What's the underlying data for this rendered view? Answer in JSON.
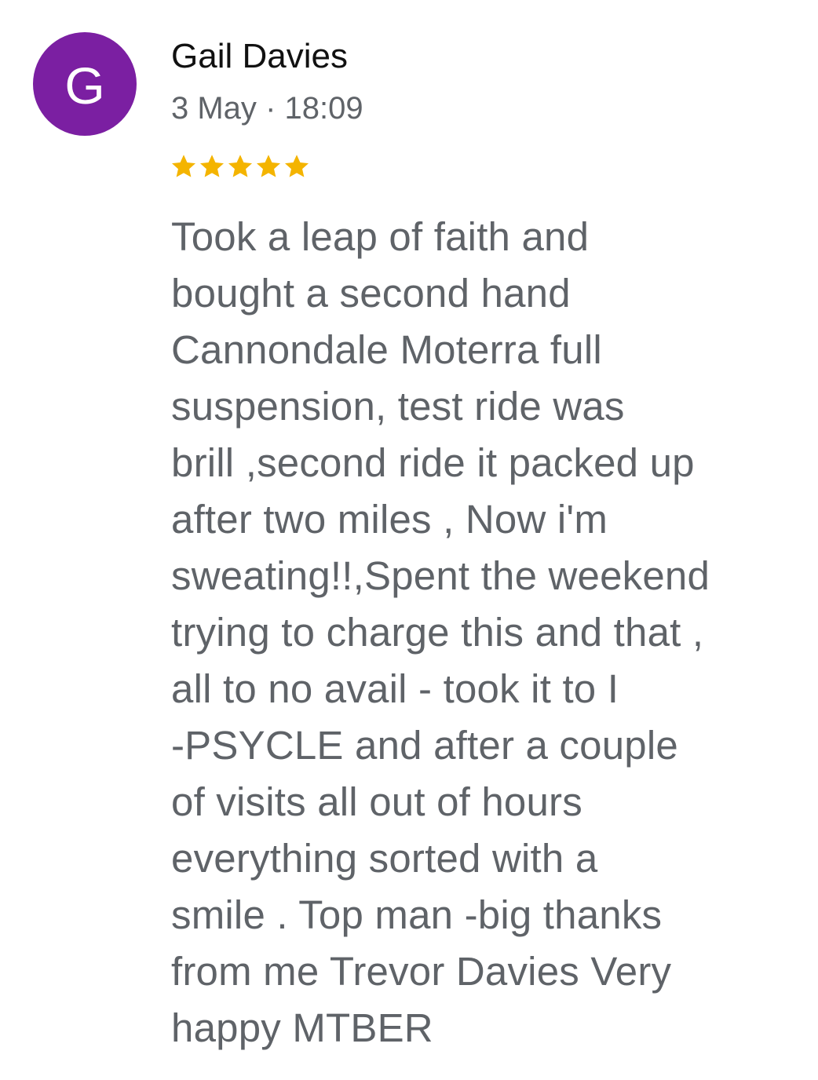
{
  "review": {
    "avatar_letter": "G",
    "avatar_color": "#7b1fa2",
    "author_name": "Gail Davies",
    "date": "3 May",
    "separator": "·",
    "time": "18:09",
    "rating": 5,
    "rating_max": 5,
    "star_color": "#f4b400",
    "star_icon": "star-icon",
    "text": "Took a leap of faith and\nbought a second hand\nCannondale Moterra full\nsuspension, test ride was\nbrill ,second ride it packed up\nafter two miles , Now i'm\nsweating!!,Spent the weekend\ntrying to charge this and that ,\nall to no avail - took it to I\n-PSYCLE  and after a couple\nof visits all out of hours\neverything sorted with a\nsmile . Top man -big thanks\nfrom me Trevor Davies Very\nhappy MTBER"
  }
}
